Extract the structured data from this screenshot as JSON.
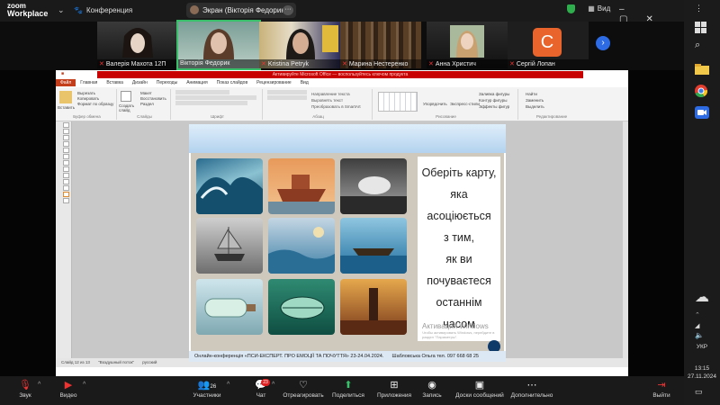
{
  "zoom": {
    "logo_line1": "zoom",
    "logo_line2": "Workplace",
    "meeting_label": "Конференция",
    "screen_share_label": "Экран (Вікторія Федорик)",
    "view_label": "Вид",
    "colors": {
      "bar": "#1a1a1a",
      "active_speaker": "#3ac06a",
      "record": "#e02020"
    }
  },
  "participants": [
    {
      "name": "Валерія Махота 12П",
      "muted": true
    },
    {
      "name": "Вікторія Федорик",
      "muted": false,
      "active": true
    },
    {
      "name": "Kristina Petryk",
      "muted": true
    },
    {
      "name": "Марина Нестеренко",
      "muted": true
    },
    {
      "name": "Анна Христич",
      "muted": true
    },
    {
      "name": "Сергій Лопан",
      "muted": true,
      "avatar_letter": "C"
    }
  ],
  "powerpoint": {
    "title_text": "",
    "red_notice": "Активируйте Microsoft Office — воспользуйтесь ключом продукта",
    "tabs": [
      "Файл",
      "Главная",
      "Вставка",
      "Дизайн",
      "Переходы",
      "Анимация",
      "Показ слайдов",
      "Рецензирование",
      "Вид"
    ],
    "ribbon_groups": [
      "Буфер обмена",
      "Слайды",
      "Шрифт",
      "Абзац",
      "Рисование",
      "Редактирование"
    ],
    "clipboard_items": [
      "Вырезать",
      "Копировать",
      "Формат по образцу"
    ],
    "paste_label": "Вставить",
    "new_slide_label": "Создать слайд",
    "slide_items": [
      "Макет",
      "Восстановить",
      "Раздел"
    ],
    "paragraph_items": [
      "Направление текста",
      "Выровнять текст",
      "Преобразовать в SmartArt"
    ],
    "drawing_items": [
      "Упорядочить",
      "Экспресс-стили",
      "Заливка фигуры",
      "Контур фигуры",
      "Эффекты фигур"
    ],
    "editing_items": [
      "Найти",
      "Заменить",
      "Выделить"
    ],
    "status_slide": "Слайд 12 из 13",
    "status_theme": "\"Воздушный поток\"",
    "status_lang": "русский"
  },
  "slide": {
    "text_lines": [
      "Оберіть карту,",
      "яка",
      "асоціюється",
      "з тим,",
      "як ви",
      "почуваєтеся",
      "останнім",
      "часом"
    ],
    "footer_left": "Онлайн-конференція «ПСИ-ЕКСПЕРТ. ПРО ЕМОЦІЇ ТА ПОЧУТТЯ» 23-24.04.2024.",
    "footer_right": "Шабловська Ольга тел. 097 668 68 25",
    "watermark": "Активация Windows",
    "watermark_sub": "Чтобы активировать Windows, перейдите в раздел \"Параметры\"."
  },
  "taskbar": {
    "time": "13:15",
    "date": "27.11.2024",
    "lang": "УКР"
  },
  "toolbar": {
    "buttons": [
      {
        "label": "Звук",
        "icon": "mic-muted-icon"
      },
      {
        "label": "Видео",
        "icon": "video-muted-icon"
      },
      {
        "label": "Участники",
        "icon": "participants-icon",
        "count": "26"
      },
      {
        "label": "Чат",
        "icon": "chat-icon",
        "badge": "23"
      },
      {
        "label": "Отреагировать",
        "icon": "heart-icon"
      },
      {
        "label": "Поделиться",
        "icon": "share-icon"
      },
      {
        "label": "Приложения",
        "icon": "apps-icon"
      },
      {
        "label": "Запись",
        "icon": "record-icon"
      },
      {
        "label": "Доски сообщений",
        "icon": "whiteboard-icon"
      },
      {
        "label": "Дополнительно",
        "icon": "more-icon"
      },
      {
        "label": "Выйти",
        "icon": "leave-icon"
      }
    ]
  }
}
